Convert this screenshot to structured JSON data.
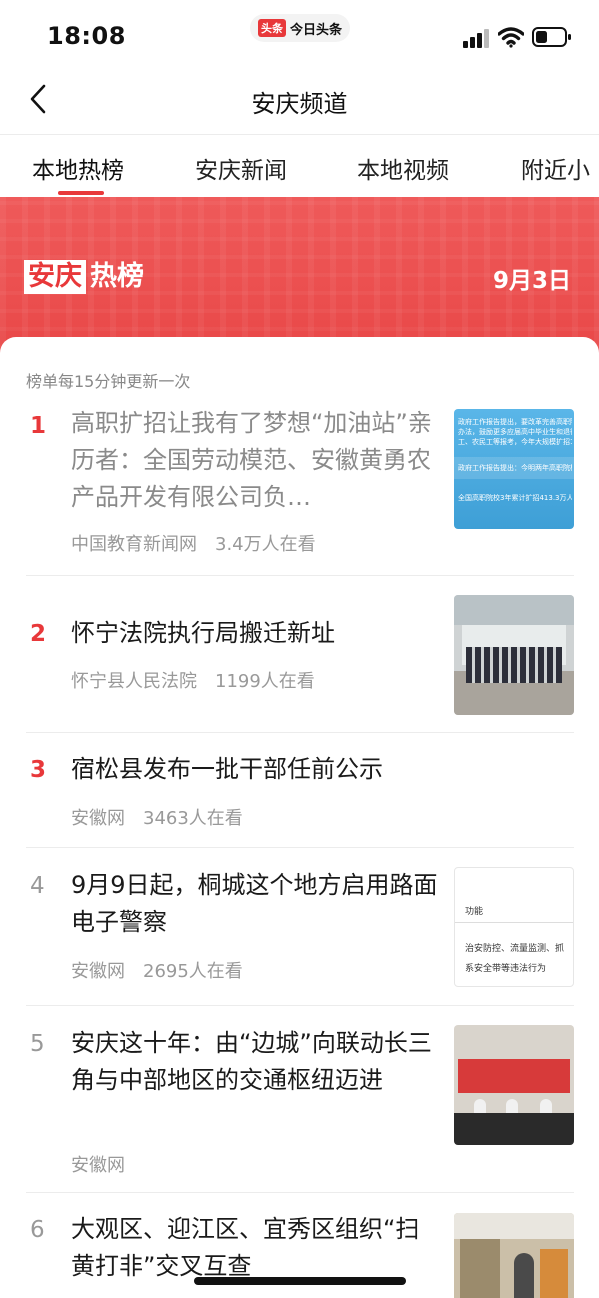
{
  "status": {
    "time": "18:08",
    "app_logo": "头条",
    "app_name": "今日头条"
  },
  "nav": {
    "title": "安庆频道",
    "back_icon": "chevron-left-icon"
  },
  "tabs": [
    {
      "label": "本地热榜",
      "active": true
    },
    {
      "label": "安庆新闻",
      "active": false
    },
    {
      "label": "本地视频",
      "active": false
    },
    {
      "label": "附近小",
      "active": false
    }
  ],
  "banner": {
    "city": "安庆",
    "hot": "热榜",
    "date": "9月3日",
    "color": "#e8383a"
  },
  "list": {
    "update_note": "榜单每15分钟更新一次",
    "items": [
      {
        "rank": "1",
        "title": "高职扩招让我有了梦想“加油站”亲历者：全国劳动模范、安徽黄勇农产品开发有限公司负…",
        "source": "中国教育新闻网",
        "views": "3.4万人在看",
        "read": true
      },
      {
        "rank": "2",
        "title": "怀宁法院执行局搬迁新址",
        "source": "怀宁县人民法院",
        "views": "1199人在看",
        "read": false
      },
      {
        "rank": "3",
        "title": "宿松县发布一批干部任前公示",
        "source": "安徽网",
        "views": "3463人在看",
        "read": false
      },
      {
        "rank": "4",
        "title": "9月9日起，桐城这个地方启用路面电子警察",
        "source": "安徽网",
        "views": "2695人在看",
        "read": false
      },
      {
        "rank": "5",
        "title": "安庆这十年：由“边城”向联动长三角与中部地区的交通枢纽迈进",
        "source": "安徽网",
        "views": "",
        "read": false
      },
      {
        "rank": "6",
        "title": "大观区、迎江区、宜秀区组织“扫黄打非”交叉互查",
        "source": "",
        "views": "",
        "read": false
      }
    ],
    "thumb_texts": {
      "t1_a": "政府工作报告提出，要改革完善高职院校",
      "t1_b": "办法，鼓励更多应届高中毕业生和退役军人",
      "t1_c": "工、农民工等报考，今年大规模扩招100万人",
      "t1_d": "政府工作报告提出：今明两年高职院校扩招200",
      "t1_e": "全国高职院校3年累计扩招413.3万人",
      "t4_a": "功能",
      "t4_b": "治安防控、流量监测、抓",
      "t4_c": "系安全带等违法行为"
    }
  }
}
